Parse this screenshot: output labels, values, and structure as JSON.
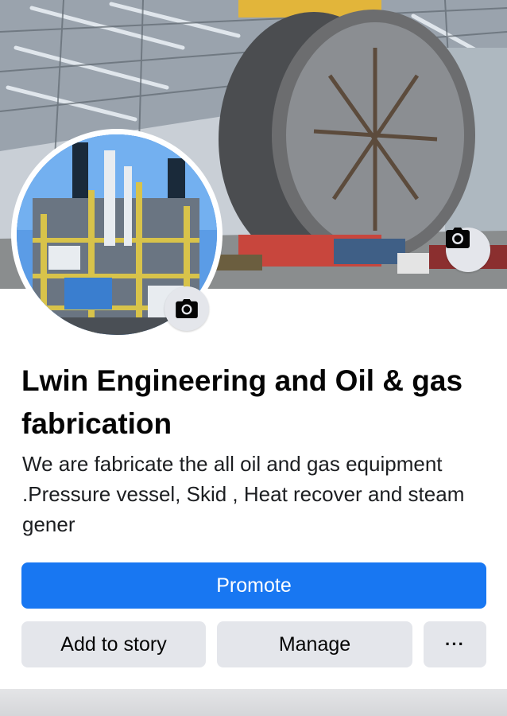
{
  "page": {
    "title": "Lwin Engineering and Oil & gas fabrication",
    "bio": "We are fabricate the all oil and gas equipment .Pressure vessel, Skid , Heat recover and steam gener"
  },
  "buttons": {
    "promote": "Promote",
    "add_to_story": "Add to story",
    "manage": "Manage",
    "more": "···"
  },
  "icons": {
    "cover_camera": "camera-icon",
    "profile_camera": "camera-icon"
  },
  "colors": {
    "primary": "#1877f2",
    "secondary_button": "#e4e6eb",
    "text": "#050505"
  }
}
